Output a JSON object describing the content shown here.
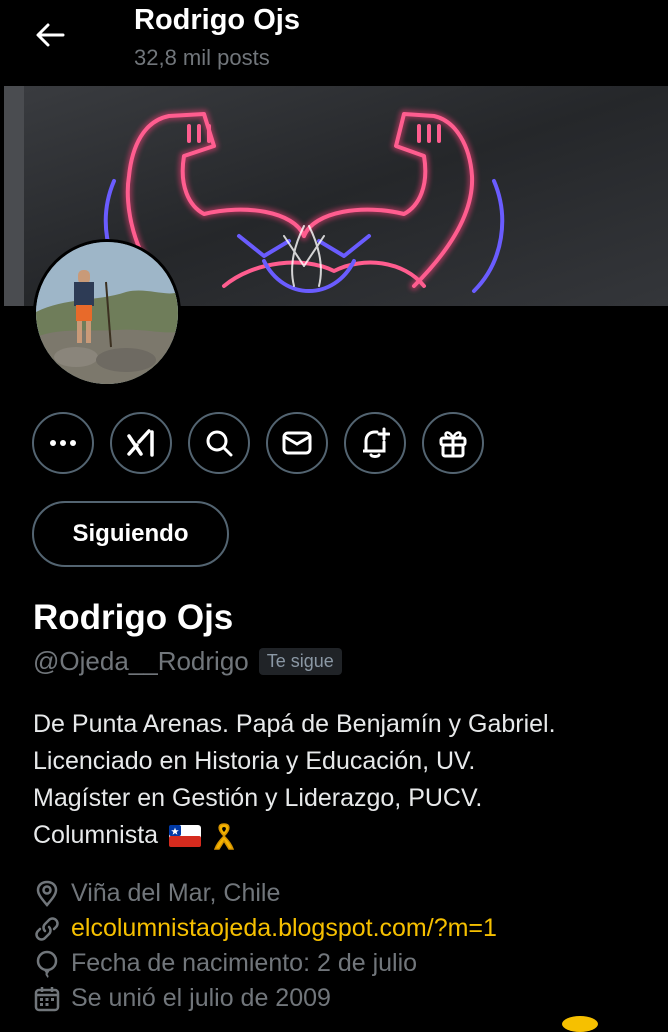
{
  "header": {
    "name": "Rodrigo Ojs",
    "posts": "32,8 mil posts"
  },
  "actions": {
    "more": "more-icon",
    "grok": "grok-icon",
    "search": "search-icon",
    "message": "mail-icon",
    "notifications": "bell-plus-icon",
    "gift": "gift-icon"
  },
  "follow_button": "Siguiendo",
  "profile": {
    "name": "Rodrigo Ojs",
    "handle": "@Ojeda__Rodrigo",
    "follows_you": "Te sigue"
  },
  "bio": {
    "line1": "De Punta Arenas. Papá de Benjamín y Gabriel.",
    "line2": "Licenciado en Historia y Educación, UV.",
    "line3": "Magíster en Gestión y Liderazgo, PUCV.",
    "line4": "Columnista"
  },
  "meta": {
    "location": "Viña del Mar, Chile",
    "website": "elcolumnistaojeda.blogspot.com/?m=1",
    "birthday": "Fecha de nacimiento: 2 de julio",
    "joined": "Se unió el julio de 2009"
  },
  "colors": {
    "background": "#000000",
    "muted": "#71767b",
    "link": "#f6c000",
    "border": "#536471"
  }
}
